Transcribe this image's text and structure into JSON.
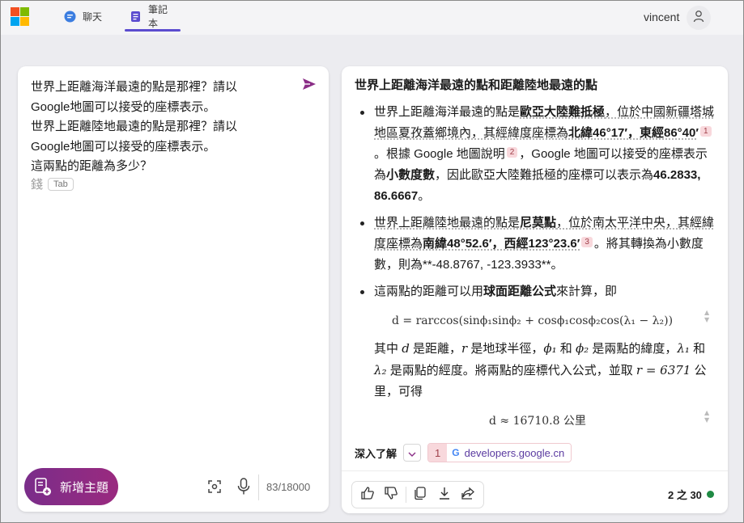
{
  "header": {
    "tabs": [
      {
        "label": "聊天",
        "icon": "chat-icon",
        "active": false
      },
      {
        "label": "筆記本",
        "icon": "notebook-icon",
        "active": true
      }
    ],
    "user_name": "vincent",
    "avatar_icon": "person-icon"
  },
  "colors": {
    "accent": "#5b4ccf",
    "brand_gradient_start": "#7a2d8a",
    "brand_gradient_end": "#9a2a7f",
    "citation_bg": "#f8d8dc",
    "status_green": "#1f8a44"
  },
  "composer": {
    "query_lines": [
      "世界上距離海洋最遠的點是那裡？請以",
      "Google地圖可以接受的座標表示。",
      "世界上距離陸地最遠的點是那裡？請以",
      "Google地圖可以接受的座標表示。",
      "這兩點的距離為多少？"
    ],
    "suggestion_prefix": "錢",
    "tab_key": "Tab",
    "new_topic_label": "新增主題",
    "char_count": "83/18000"
  },
  "response": {
    "title": "世界上距離海洋最遠的點和距離陸地最遠的點",
    "b1": {
      "t1": "世界上距離海洋最遠的點是",
      "b_name": "歐亞大陸難抵極",
      "t2": "，位於中國新疆塔城地區夏孜蓋鄉境內，其經緯度座標為",
      "b_coord": "北緯46°17′，東經86°40′",
      "c1": "1",
      "t3": "。根據 Google 地圖說明",
      "c2": "2",
      "t4": "，Google 地圖可以接受的座標表示為",
      "b_fmt": "小數度數",
      "t5": "，因此歐亞大陸難抵極的座標可以表示為",
      "b_dec": "46.2833, 86.6667",
      "t6": "。"
    },
    "b2": {
      "t1": "世界上距離陸地最遠的點是",
      "b_name": "尼莫點",
      "t2": "，位於南太平洋中央，其經緯度座標為",
      "b_coord": "南緯48°52.6′，西經123°23.6′",
      "c3": "3",
      "t3": "。將其轉換為小數度數，則為**-48.8767, -123.3933**。"
    },
    "b3": {
      "t1": "這兩點的距離可以用",
      "b_formula": "球面距離公式",
      "t2": "來計算，即",
      "formula": "d = rarccos(sinϕ₁sinϕ₂ + cosϕ₁cosϕ₂cos(λ₁ − λ₂))",
      "e1": "其中",
      "v_d": "d",
      "e2": "是距離，",
      "v_r": "r",
      "e3": "是地球半徑，",
      "v_phi1": "ϕ₁",
      "e4": "和",
      "v_phi2": "ϕ₂",
      "e5": "是兩點的緯度，",
      "v_lam1": "λ₁",
      "e6": "和",
      "v_lam2": "λ₂",
      "e7": "是兩點的經度。將兩點的座標代入公式，並取",
      "r_val": "r = 6371",
      "e8": "公里，可得",
      "result": "d ≈ 16710.8 公里"
    },
    "learn_more_label": "深入了解",
    "sources": [
      {
        "num": "1",
        "domain": "developers.google.cn"
      }
    ],
    "page_count": "2 之 30"
  }
}
